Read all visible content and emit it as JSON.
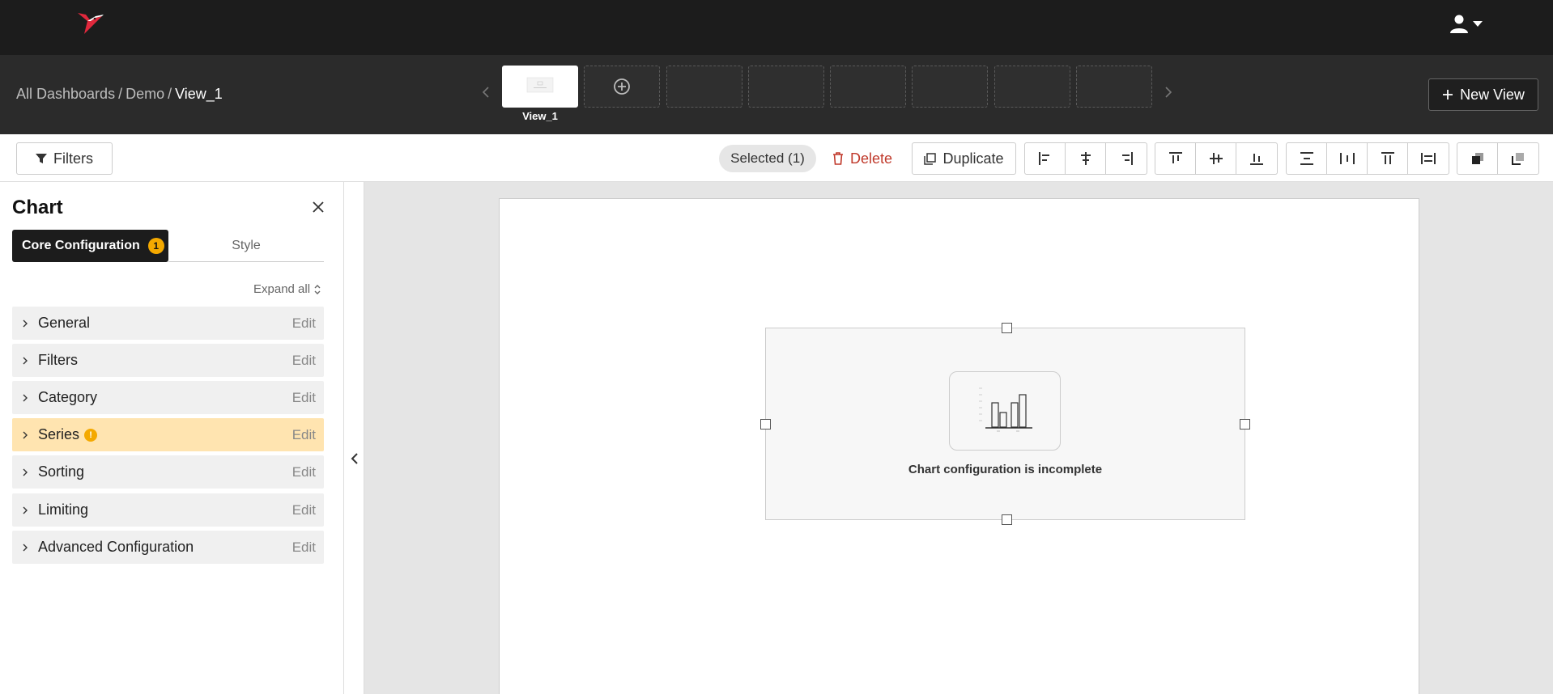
{
  "header": {
    "logo_icon": "hummingbird-logo-icon",
    "user_icon": "user-icon",
    "accent": "#e0283c"
  },
  "breadcrumb": {
    "items": [
      "All Dashboards",
      "Demo"
    ],
    "separator": "/",
    "current": "View_1"
  },
  "views": {
    "active_label": "View_1",
    "new_view_label": "New View"
  },
  "toolbar": {
    "filters_label": "Filters",
    "selected_label": "Selected (1)",
    "delete_label": "Delete",
    "duplicate_label": "Duplicate",
    "delete_color": "#c0392b"
  },
  "panel": {
    "title": "Chart",
    "tabs": {
      "core_label": "Core Configuration",
      "core_badge": "1",
      "style_label": "Style"
    },
    "expand_all_label": "Expand all",
    "edit_label": "Edit",
    "sections": [
      {
        "label": "General",
        "warning": false
      },
      {
        "label": "Filters",
        "warning": false
      },
      {
        "label": "Category",
        "warning": false
      },
      {
        "label": "Series",
        "warning": true,
        "warning_mark": "!"
      },
      {
        "label": "Sorting",
        "warning": false
      },
      {
        "label": "Limiting",
        "warning": false
      },
      {
        "label": "Advanced Configuration",
        "warning": false
      }
    ]
  },
  "canvas": {
    "widget_message": "Chart configuration is incomplete",
    "placeholder_icon": "bar-chart-icon"
  }
}
